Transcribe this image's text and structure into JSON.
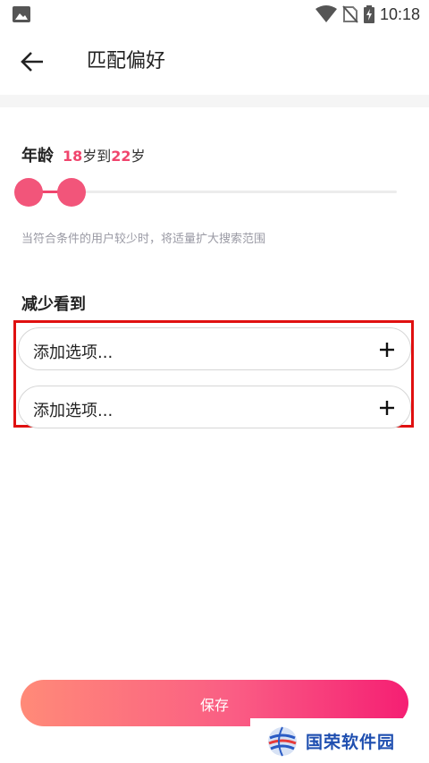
{
  "status_bar": {
    "time": "10:18",
    "icons": [
      "image-icon",
      "wifi-icon",
      "no-sim-icon",
      "battery-charging-icon"
    ]
  },
  "header": {
    "title": "匹配偏好",
    "back_icon": "arrow-left-icon"
  },
  "age": {
    "label": "年龄",
    "min": "18",
    "min_unit": "岁到",
    "max": "22",
    "max_unit": "岁",
    "hint": "当符合条件的用户较少时，将适量扩大搜索范围"
  },
  "reduce": {
    "title": "减少看到",
    "options": [
      {
        "label": "添加选项..."
      },
      {
        "label": "添加选项..."
      }
    ]
  },
  "save_label": "保存",
  "watermark": {
    "text": "国荣软件园"
  },
  "colors": {
    "accent": "#f0456d",
    "highlight_border": "#e01010",
    "button_gradient_start": "#ff8a78",
    "button_gradient_end": "#f51f73",
    "watermark_text": "#1f4fb0"
  }
}
